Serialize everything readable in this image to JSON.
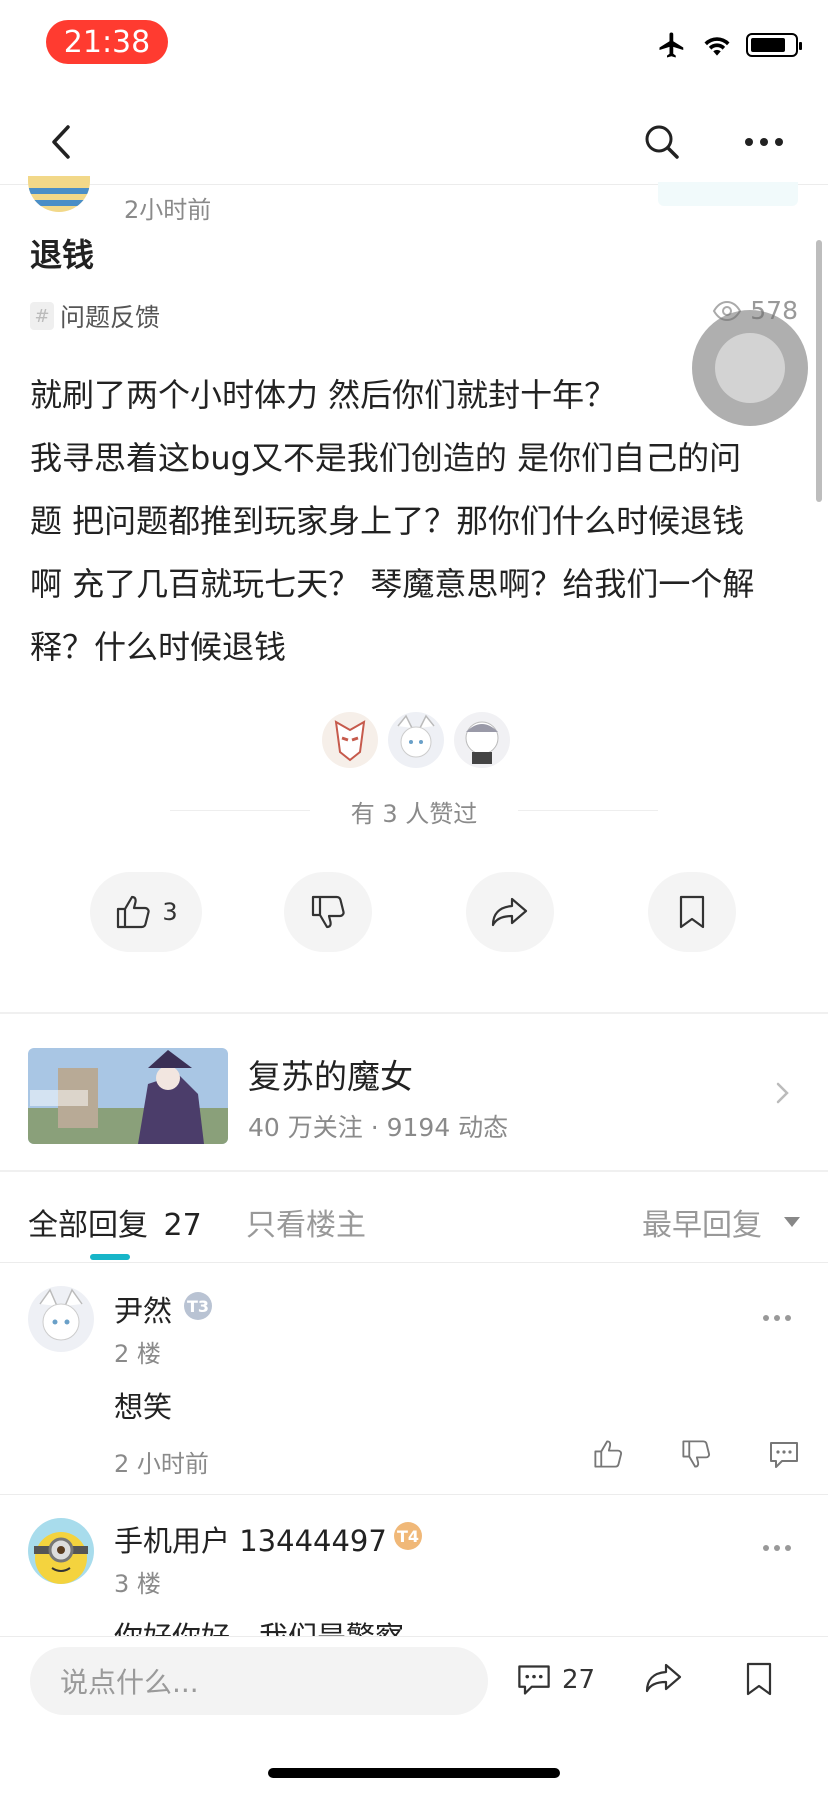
{
  "status_bar": {
    "time": "21:38"
  },
  "post": {
    "time": "2小时前",
    "title": "退钱",
    "topic": "问题反馈",
    "views": "578",
    "body_lines": [
      " 就刷了两个小时体力 然后你们就封十年？",
      "我寻思着这bug又不是我们创造的 是你们自己的问",
      "题 把问题都推到玩家身上了？那你们什么时候退钱",
      "啊 充了几百就玩七天？ 琴魔意思啊？给我们一个解",
      "释？什么时候退钱"
    ],
    "likers_caption": "有 3 人赞过",
    "like_count": "3"
  },
  "game_card": {
    "name": "复苏的魔女",
    "meta": "40 万关注 · 9194 动态"
  },
  "tabs": {
    "all_label": "全部回复",
    "all_count": "27",
    "owner_only": "只看楼主",
    "sort": "最早回复"
  },
  "comments": [
    {
      "name": "尹然",
      "badge": "T3",
      "floor": "2 楼",
      "text": "想笑",
      "time": "2 小时前"
    },
    {
      "name": "手机用户 13444497",
      "badge": "T4",
      "floor": "3 楼",
      "text": "你好你好，我们是警察"
    }
  ],
  "bottom_bar": {
    "placeholder": "说点什么...",
    "comment_count": "27"
  },
  "colors": {
    "accent": "#17b5c8",
    "time_pill": "#ff3b30"
  }
}
